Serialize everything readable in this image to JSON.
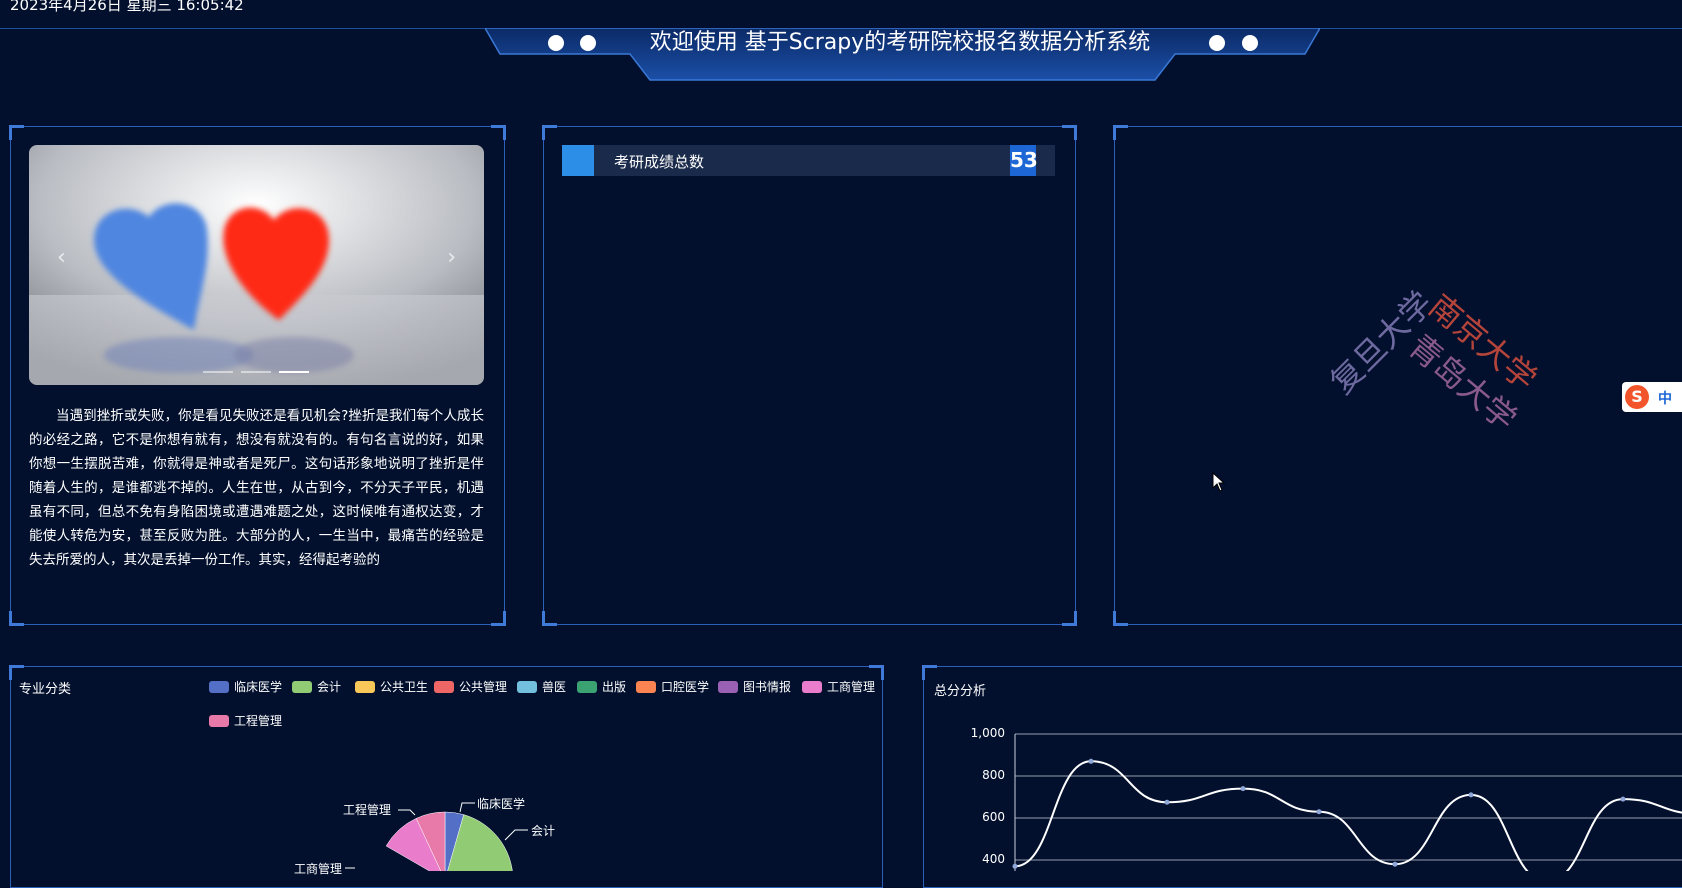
{
  "header": {
    "datetime": "2023年4月26日 星期三 16:05:42",
    "title": "欢迎使用 基于Scrapy的考研院校报名数据分析系统"
  },
  "carousel": {
    "prev_icon": "chevron-left-icon",
    "next_icon": "chevron-right-icon",
    "slide_count": 3,
    "active_index": 2
  },
  "article": {
    "text": "当遇到挫折或失败，你是看见失败还是看见机会?挫折是我们每个人成长的必经之路，它不是你想有就有，想没有就没有的。有句名言说的好，如果你想一生摆脱苦难，你就得是神或者是死尸。这句话形象地说明了挫折是伴随着人生的，是谁都逃不掉的。人生在世，从古到今，不分天子平民，机遇虽有不同，但总不免有身陷困境或遭遇难题之处，这时候唯有通权达变，才能使人转危为安，甚至反败为胜。大部分的人，一生当中，最痛苦的经验是失去所爱的人，其次是丢掉一份工作。其实，经得起考验的"
  },
  "stat": {
    "label": "考研成绩总数",
    "value": "53"
  },
  "wordcloud": {
    "words": [
      {
        "text": "南京大学",
        "color": "#b5443a"
      },
      {
        "text": "复旦大学",
        "color": "#6e6aa0"
      },
      {
        "text": "青岛大学",
        "color": "#8a5a8c"
      }
    ]
  },
  "ime": {
    "zh_label": "中"
  },
  "pie_section": {
    "title": "专业分类",
    "legend": [
      {
        "name": "临床医学",
        "color": "#5470c6"
      },
      {
        "name": "会计",
        "color": "#91cc75"
      },
      {
        "name": "公共卫生",
        "color": "#fac858"
      },
      {
        "name": "公共管理",
        "color": "#ee6666"
      },
      {
        "name": "兽医",
        "color": "#73c0de"
      },
      {
        "name": "出版",
        "color": "#3ba272"
      },
      {
        "name": "口腔医学",
        "color": "#fc8452"
      },
      {
        "name": "图书情报",
        "color": "#9a60b4"
      },
      {
        "name": "工商管理",
        "color": "#ea7ccc"
      },
      {
        "name": "工程管理",
        "color": "#e77aa8"
      }
    ],
    "visible_labels": [
      "工程管理",
      "临床医学",
      "会计",
      "工商管理"
    ]
  },
  "line_section": {
    "title": "总分分析"
  },
  "chart_data": [
    {
      "type": "pie",
      "title": "专业分类",
      "categories": [
        "临床医学",
        "会计",
        "公共卫生",
        "公共管理",
        "兽医",
        "出版",
        "口腔医学",
        "图书情报",
        "工商管理",
        "工程管理"
      ],
      "legend_placement": "top"
    },
    {
      "type": "line",
      "title": "总分分析",
      "y_ticks": [
        "1,000",
        "800",
        "600",
        "400"
      ],
      "ylim": [
        400,
        1000
      ],
      "grid": true,
      "series": [
        {
          "values": [
            370,
            870,
            675,
            740,
            630,
            380,
            710,
            300,
            690,
            620
          ]
        }
      ]
    }
  ]
}
